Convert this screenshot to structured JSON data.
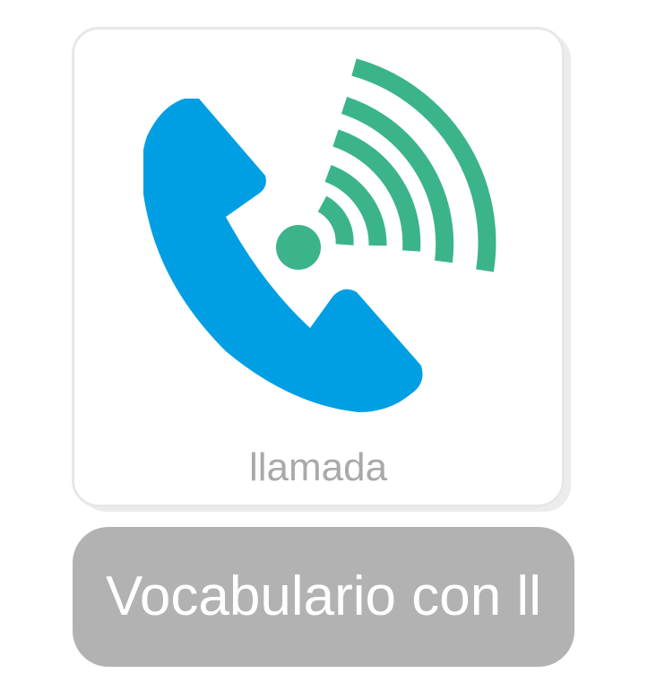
{
  "card": {
    "word": "llamada",
    "icon": "phone-call-signal-icon"
  },
  "category": {
    "label": "Vocabulario con ll"
  },
  "colors": {
    "handset": "#009fe3",
    "signal": "#3bb48a",
    "card_border": "#e7e7e7",
    "word_text": "#a9a9a9",
    "button_bg": "#b2b2b2",
    "button_text": "#ffffff"
  }
}
